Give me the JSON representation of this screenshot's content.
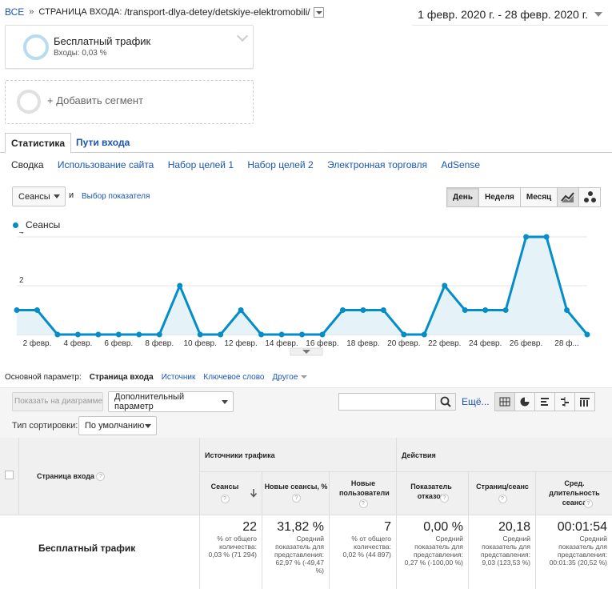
{
  "breadcrumb": {
    "all": "ВСЕ",
    "sep": "»",
    "label": "СТРАНИЦА ВХОДА:",
    "path": "/transport-dlya-detey/detskiye-elektromobili/"
  },
  "date_range": "1 февр. 2020 г. - 28 февр. 2020 г.",
  "segments": {
    "active": {
      "name": "Бесплатный трафик",
      "sub": "Входы: 0,03 %"
    },
    "add": "+ Добавить сегмент"
  },
  "tabs": [
    {
      "label": "Статистика"
    },
    {
      "label": "Пути входа"
    }
  ],
  "subtabs": [
    "Сводка",
    "Использование сайта",
    "Набор целей 1",
    "Набор целей 2",
    "Электронная торговля",
    "AdSense"
  ],
  "metric_selector": {
    "value": "Сеансы",
    "and": "и",
    "choose": "Выбор показателя"
  },
  "period": [
    "День",
    "Неделя",
    "Месяц"
  ],
  "chart_data": {
    "type": "area",
    "series": [
      {
        "name": "Сеансы",
        "values": [
          1,
          1,
          0,
          0,
          0,
          0,
          0,
          0,
          2,
          0,
          0,
          1,
          0,
          0,
          0,
          0,
          1,
          1,
          1,
          0,
          0,
          2,
          1,
          1,
          1,
          4,
          4,
          1,
          0
        ]
      }
    ],
    "y_ticks": [
      "2",
      "4"
    ],
    "ylim": [
      0,
      4
    ],
    "x_tick_labels": [
      "2 февр.",
      "4 февр.",
      "6 февр.",
      "8 февр.",
      "10 февр.",
      "12 февр.",
      "14 февр.",
      "16 февр.",
      "18 февр.",
      "20 февр.",
      "22 февр.",
      "24 февр.",
      "26 февр.",
      "28 ф..."
    ],
    "color": "#058dc7",
    "fill": "#e5f3f9"
  },
  "dimensions": {
    "label": "Основной параметр:",
    "current": "Страница входа",
    "items": [
      "Источник",
      "Ключевое слово"
    ],
    "other": "Другое"
  },
  "toolbar": {
    "plot": "Показать на диаграмме",
    "secondary": "Дополнительный параметр",
    "more": "Ещё...",
    "sort_label": "Тип сортировки:",
    "sort_value": "По умолчанию"
  },
  "table": {
    "dim_header": "Страница входа",
    "groups": [
      "Источники трафика",
      "Действия"
    ],
    "columns": [
      {
        "label": "Сеансы",
        "value": "22",
        "sub": "% от общего количества: 0,03 % (71 294)"
      },
      {
        "label": "Новые сеансы, %",
        "value": "31,82 %",
        "sub": "Средний показатель для представления: 62,97 % (-49,47 %)"
      },
      {
        "label": "Новые пользователи",
        "value": "7",
        "sub": "% от общего количества: 0,02 % (44 897)"
      },
      {
        "label": "Показатель отказов",
        "value": "0,00 %",
        "sub": "Средний показатель для представления: 0,27 % (-100,00 %)"
      },
      {
        "label": "Страниц/сеанс",
        "value": "20,18",
        "sub": "Средний показатель для представления: 9,03 (123,53 %)"
      },
      {
        "label": "Сред. длительность сеанса",
        "value": "00:01:54",
        "sub": "Средний показатель для представления: 00:01:35 (20,52 %)"
      }
    ],
    "row_label": "Бесплатный трафик"
  }
}
